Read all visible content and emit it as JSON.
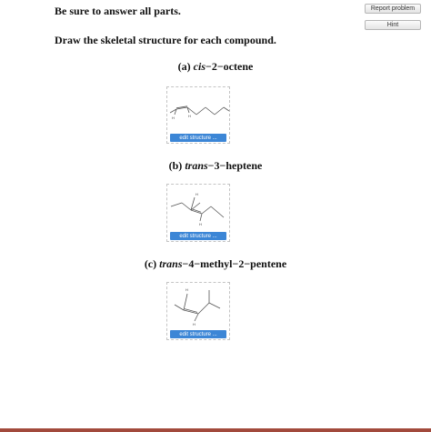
{
  "header": {
    "instruction": "Be sure to answer all parts.",
    "prompt": "Draw the skeletal structure for each compound.",
    "report_label": "Report problem",
    "hint_label": "Hint"
  },
  "parts": [
    {
      "letter": "(a)",
      "prefix": "cis",
      "name": "−2−octene",
      "edit_label": "edit structure ..."
    },
    {
      "letter": "(b)",
      "prefix": "trans",
      "name": "−3−heptene",
      "edit_label": "edit structure ..."
    },
    {
      "letter": "(c)",
      "prefix": "trans",
      "name": "−4−methyl−2−pentene",
      "edit_label": "edit structure ..."
    }
  ],
  "atom_labels": {
    "h": "H"
  },
  "colors": {
    "edit_button": "#3c86d6",
    "footer_bar": "#a24a3c"
  }
}
